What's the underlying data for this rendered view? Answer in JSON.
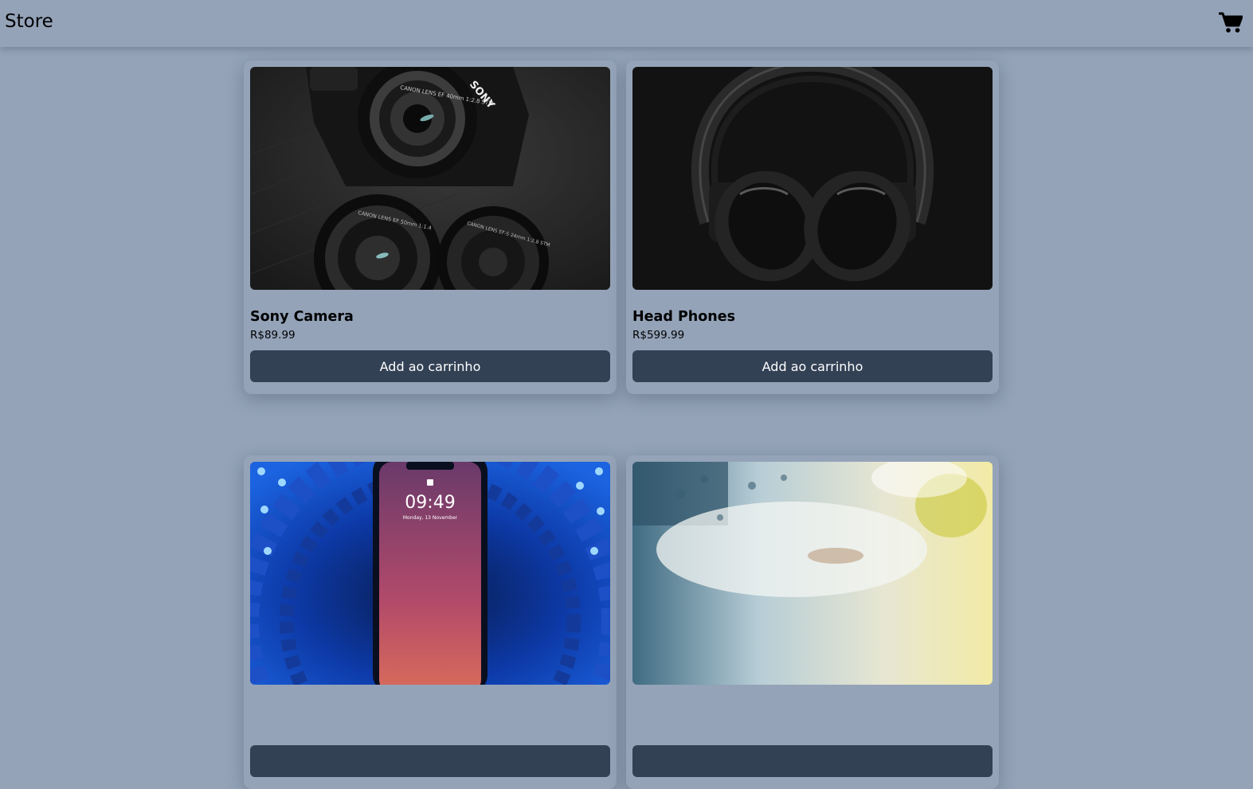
{
  "header": {
    "brand": "Store",
    "cart_icon": "shopping-cart-icon"
  },
  "products": [
    {
      "name": "Sony Camera",
      "price": "R$89.99",
      "button_label": "Add ao carrinho"
    },
    {
      "name": "Head Phones",
      "price": "R$599.99",
      "button_label": "Add ao carrinho"
    },
    {
      "name": "",
      "price": "",
      "button_label": ""
    },
    {
      "name": "",
      "price": "",
      "button_label": ""
    }
  ],
  "colors": {
    "background": "#94a3b8",
    "button": "#334155",
    "button_text": "#ffffff"
  },
  "camera_image_texts": {
    "brand": "SONY",
    "lens_a": "CANON LENS EF 40mm 1:2.8 STM",
    "lens_b": "CANON LENS EF 50mm 1:1.4",
    "lens_c": "CANON LENS EF-S 24mm 1:2.8 STM"
  },
  "phone_image_texts": {
    "time": "09:49",
    "date": "Monday, 13 November"
  }
}
